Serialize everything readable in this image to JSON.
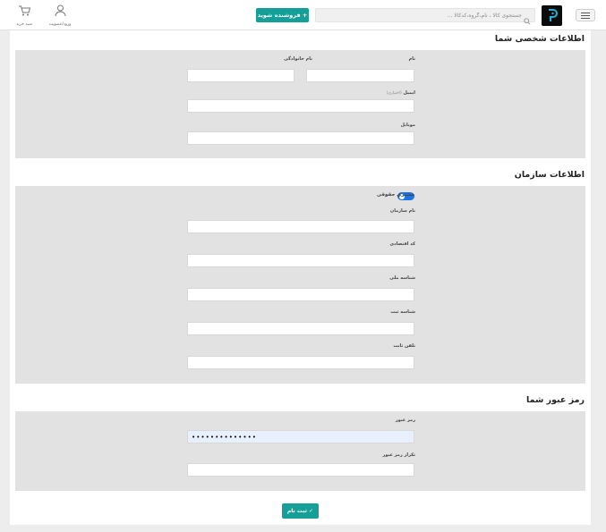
{
  "header": {
    "search_placeholder": "جستجوی کالا ، نام،گروه،کدکالا ...",
    "sell_button": "+ فروشنده شوید",
    "login_label": "ورود/عضویت",
    "cart_label": "سبد خرید"
  },
  "personal": {
    "title": "اطلاعات شخصی شما",
    "first_name_label": "نام",
    "last_name_label": "نام خانوادگی",
    "email_label": "ایمیل",
    "email_optional": "(اختیاری)",
    "mobile_label": "موبایل"
  },
  "organization": {
    "title": "اطلاعات سازمان",
    "legal_toggle_label": "مشتری حقوقی",
    "legal_toggle_on": true,
    "org_name_label": "نام سازمان",
    "economic_code_label": "کد اقتصادی",
    "national_id_label": "شناسه ملی",
    "registration_id_label": "شناسه ثبت",
    "landline_label": "تلفن ثابت"
  },
  "password": {
    "title": "رمز عبور شما",
    "password_label": "رمز عبور",
    "password_value": "••••••••••••••",
    "confirm_label": "تکرار رمز عبور"
  },
  "submit_label": "✓ ثبت نام",
  "colors": {
    "accent": "#14a098",
    "toggle": "#1a73e8",
    "panel": "#e2e2e2"
  }
}
